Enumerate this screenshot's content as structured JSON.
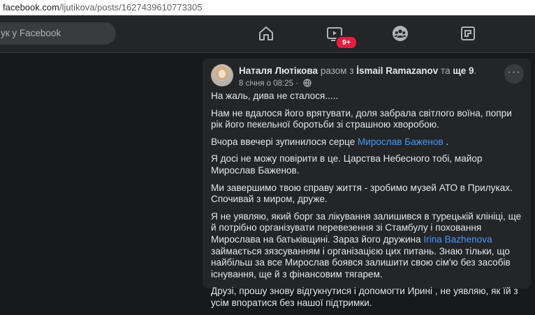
{
  "browser": {
    "url_host": "facebook.com",
    "url_path": "/ljutikova/posts/1627439610773305"
  },
  "topnav": {
    "search_text": "ук у Facebook",
    "watch_badge": "9+",
    "icons": [
      "home-icon",
      "watch-icon",
      "groups-icon",
      "gaming-icon"
    ]
  },
  "post": {
    "author": "Наталя Лютікова",
    "with_word": "разом з",
    "tagged_person": "İsmail Ramazanov",
    "and_word": "та",
    "others": "ще 9",
    "timestamp": "8 січня о 08:25",
    "privacy_dot": "·",
    "paragraphs": [
      {
        "text": "На жаль, дива не сталося....."
      },
      {
        "text": "Нам не вдалося його врятувати, доля забрала світлого воїна, попри рік його пекельної боротьби зі страшною хворобою."
      },
      {
        "before": "Вчора ввечері зупинилося серце ",
        "mention": "Мирослав Баженов",
        "after": " ."
      },
      {
        "text": "Я досі не можу повірити в це. Царства Небесного тобі, майор Мирослав Баженов."
      },
      {
        "text": "Ми завершимо твою справу життя - зробимо музей АТО в Прилуках. Спочивай з миром, друже."
      },
      {
        "before": "Я не уявляю, який борг за лікування залишився в турецькій клініці, ще й потрібно організувати перевезення зі Стамбулу і поховання Мирослава на батьківщині. Зараз його дружина ",
        "mention": "Irina Bazhenova",
        "after": " займається зязсуванням і організацією цих питань. Знаю тільки, що найбільш за все Мирослав боявся залишити свою сім'ю без засобів існування, ще й з фінансовим тягарем."
      },
      {
        "text": "Друзі, прошу знову відгукнутися і допомогти Ирині , не уявляю, як їй з усім впоратися без нашої підтримки."
      }
    ]
  }
}
